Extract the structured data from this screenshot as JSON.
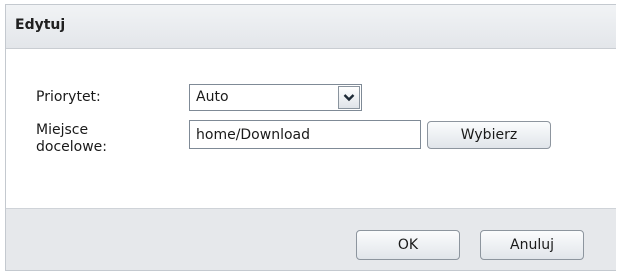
{
  "dialog": {
    "title": "Edytuj"
  },
  "form": {
    "priority_label": "Priorytet:",
    "priority_value": "Auto",
    "destination_label_line1": "Miejsce",
    "destination_label_line2": "docelowe:",
    "destination_value": "home/Download",
    "browse_label": "Wybierz"
  },
  "footer": {
    "ok_label": "OK",
    "cancel_label": "Anuluj"
  }
}
